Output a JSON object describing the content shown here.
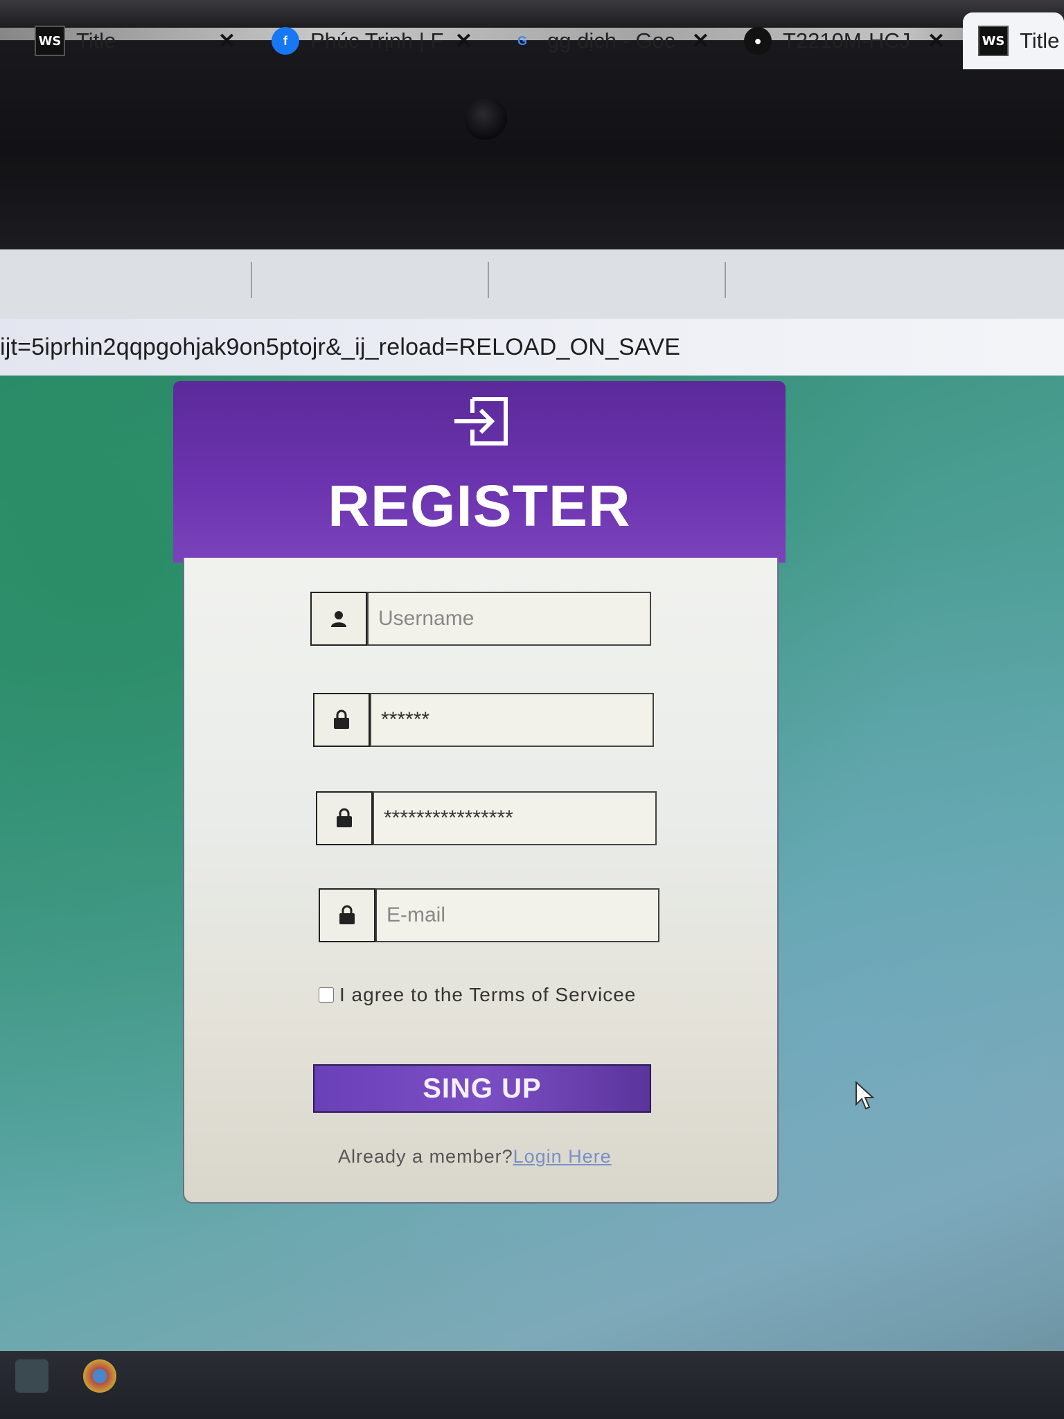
{
  "tabs": [
    {
      "favicon": "webstorm-icon",
      "title": "Title"
    },
    {
      "favicon": "facebook-icon",
      "title": "Phúc Trịnh | F"
    },
    {
      "favicon": "google-icon",
      "title": "gg dịch - Goc"
    },
    {
      "favicon": "github-icon",
      "title": "T2210M-HCJ"
    },
    {
      "favicon": "webstorm-icon",
      "title": "Title"
    }
  ],
  "tab_close_glyph": "✕",
  "address": {
    "url": "ijt=5iprhin2qqpgohjak9on5ptojr&_ij_reload=RELOAD_ON_SAVE"
  },
  "form": {
    "title": "REGISTER",
    "username_placeholder": "Username",
    "password_value": "******",
    "confirm_value": "****************",
    "email_placeholder": "E-mail",
    "terms_label": "I agree to the Terms of Servicee",
    "signup_label": "SING UP",
    "already_text": "Already a member?",
    "login_link": "Login Here"
  },
  "colors": {
    "header_purple": "#6d34b0",
    "button_purple": "#7c4ec4",
    "link_blue": "#7a8fc4"
  }
}
